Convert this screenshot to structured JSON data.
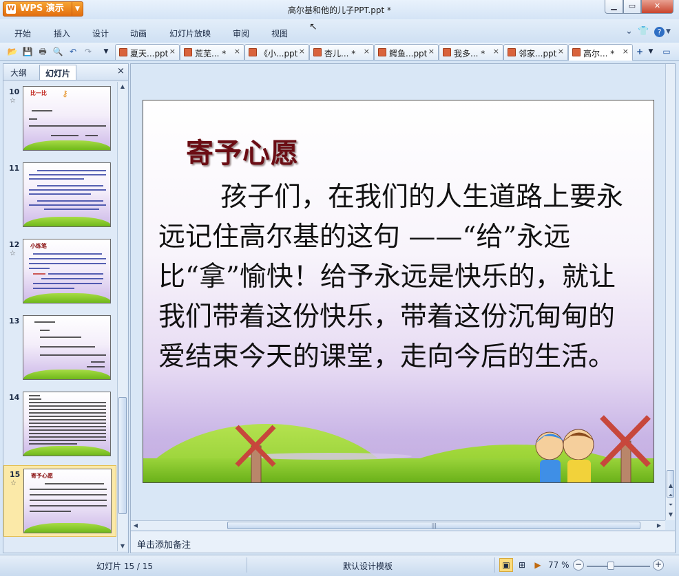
{
  "app": {
    "brand": "WPS 演示",
    "window_title": "高尔基和他的儿子PPT.ppt *"
  },
  "menu": [
    "开始",
    "插入",
    "设计",
    "动画",
    "幻灯片放映",
    "审阅",
    "视图"
  ],
  "doc_tabs": [
    {
      "label": "夏天...ppt",
      "close": "×"
    },
    {
      "label": "荒芜... *",
      "close": "×"
    },
    {
      "label": "《小...ppt",
      "close": "×"
    },
    {
      "label": "杏儿... *",
      "close": "×"
    },
    {
      "label": "鳄鱼...ppt",
      "close": "×"
    },
    {
      "label": "我多... *",
      "close": "×"
    },
    {
      "label": "邻家...ppt",
      "close": "×"
    },
    {
      "label": "高尔... *",
      "close": "×",
      "active": true
    }
  ],
  "panel": {
    "tabs": [
      "大纲",
      "幻灯片"
    ],
    "active_tab": "幻灯片",
    "close": "×"
  },
  "thumbnails": [
    {
      "num": "10",
      "star": "☆",
      "title": "比一比"
    },
    {
      "num": "11",
      "star": "",
      "title": ""
    },
    {
      "num": "12",
      "star": "☆",
      "title": "小练笔"
    },
    {
      "num": "13",
      "star": "",
      "title": ""
    },
    {
      "num": "14",
      "star": "",
      "title": ""
    },
    {
      "num": "15",
      "star": "☆",
      "title": "寄予心愿",
      "selected": true
    }
  ],
  "slide": {
    "title": "寄予心愿",
    "body": "孩子们，在我们的人生道路上要永远记住高尔基的这句 ——“给”永远比“拿”愉快！给予永远是快乐的，就让我们带着这份快乐，带着这份沉甸甸的爱结束今天的课堂，走向今后的生活。"
  },
  "notes_placeholder": "单击添加备注",
  "status": {
    "slide_counter": "幻灯片 15 / 15",
    "template": "默认设计模板",
    "zoom": "77 %"
  },
  "colors": {
    "title_red": "#6b0d14",
    "brand_orange": "#e36e10",
    "close_red": "#c9452e",
    "grass_green": "#8fd12e"
  },
  "icons": [
    "wps-logo-icon",
    "open-icon",
    "save-icon",
    "print-icon",
    "preview-icon",
    "undo-icon",
    "redo-icon",
    "document-icon",
    "close-icon",
    "shirt-icon",
    "help-icon",
    "windmill-icon"
  ]
}
